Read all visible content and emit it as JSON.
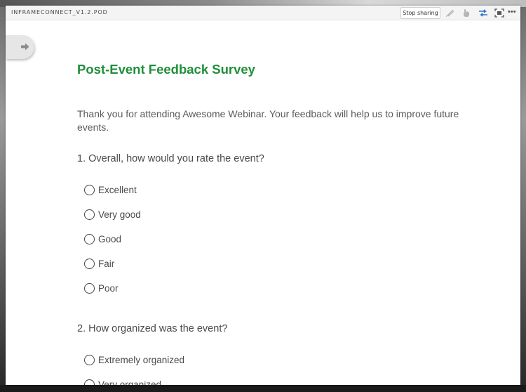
{
  "pod": {
    "title": "INFRAMECONNECT_V1.2.POD",
    "stop_sharing_label": "Stop sharing",
    "toolbar_icons": [
      "draw-icon",
      "pointer-hand-icon",
      "sync-icon",
      "fullscreen-icon",
      "more-icon"
    ],
    "more_label": "•••",
    "accent_color": "#1f8f3a"
  },
  "survey": {
    "title": "Post-Event Feedback Survey",
    "intro": "Thank you for attending Awesome Webinar. Your feedback will help us to improve future events.",
    "questions": [
      {
        "text": "1. Overall, how would you rate the event?",
        "options": [
          "Excellent",
          "Very good",
          "Good",
          "Fair",
          "Poor"
        ]
      },
      {
        "text": "2. How organized was the event?",
        "options": [
          "Extremely organized",
          "Very organized"
        ]
      }
    ]
  }
}
